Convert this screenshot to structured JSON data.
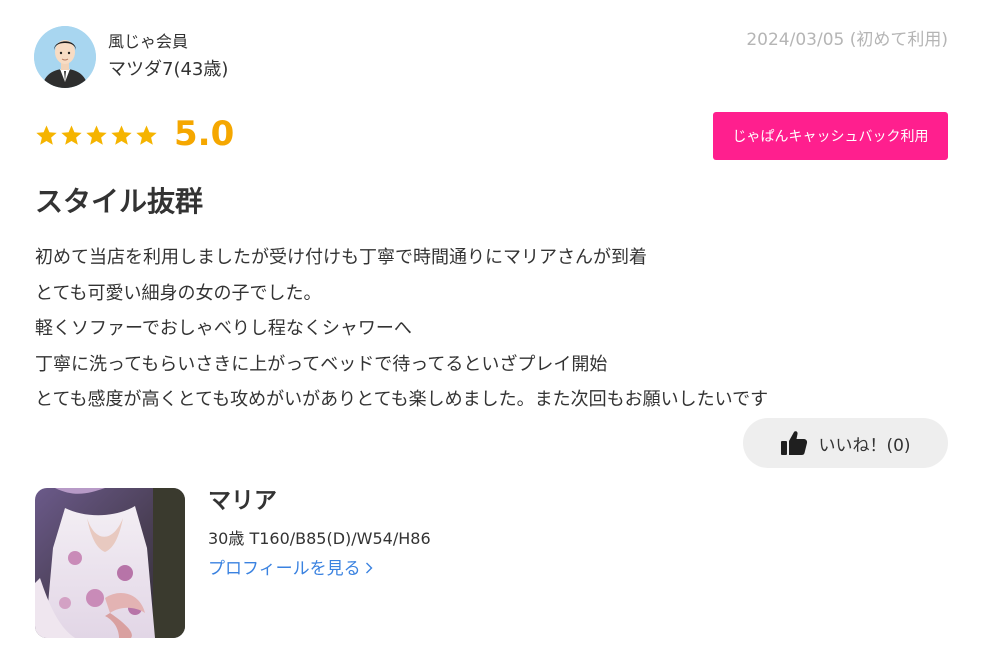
{
  "reviewer": {
    "member_type": "風じゃ会員",
    "name": "マツダ7(43歳)",
    "avatar_icon": "user-avatar-icon"
  },
  "review": {
    "date": "2024/03/05 (初めて利用)",
    "rating": "5.0",
    "stars": 5,
    "star_color": "#f5b400",
    "title": "スタイル抜群",
    "body_lines": [
      "初めて当店を利用しましたが受け付けも丁寧で時間通りにマリアさんが到着",
      "とても可愛い細身の女の子でした。",
      "軽くソファーでおしゃべりし程なくシャワーへ",
      "丁寧に洗ってもらいさきに上がってベッドで待ってるといざプレイ開始",
      "とても感度が高くとても攻めがいがありとても楽しめました。また次回もお願いしたいです"
    ]
  },
  "actions": {
    "cashback_label": "じゃぱんキャッシュバック利用",
    "cashback_color": "#ff1f8e",
    "like_label": "いいね！(0)",
    "like_icon": "thumbs-up-icon"
  },
  "cast": {
    "name": "マリア",
    "profile": "30歳 T160/B85(D)/W54/H86",
    "profile_link_label": "プロフィールを見る",
    "link_color": "#3a82e0"
  }
}
